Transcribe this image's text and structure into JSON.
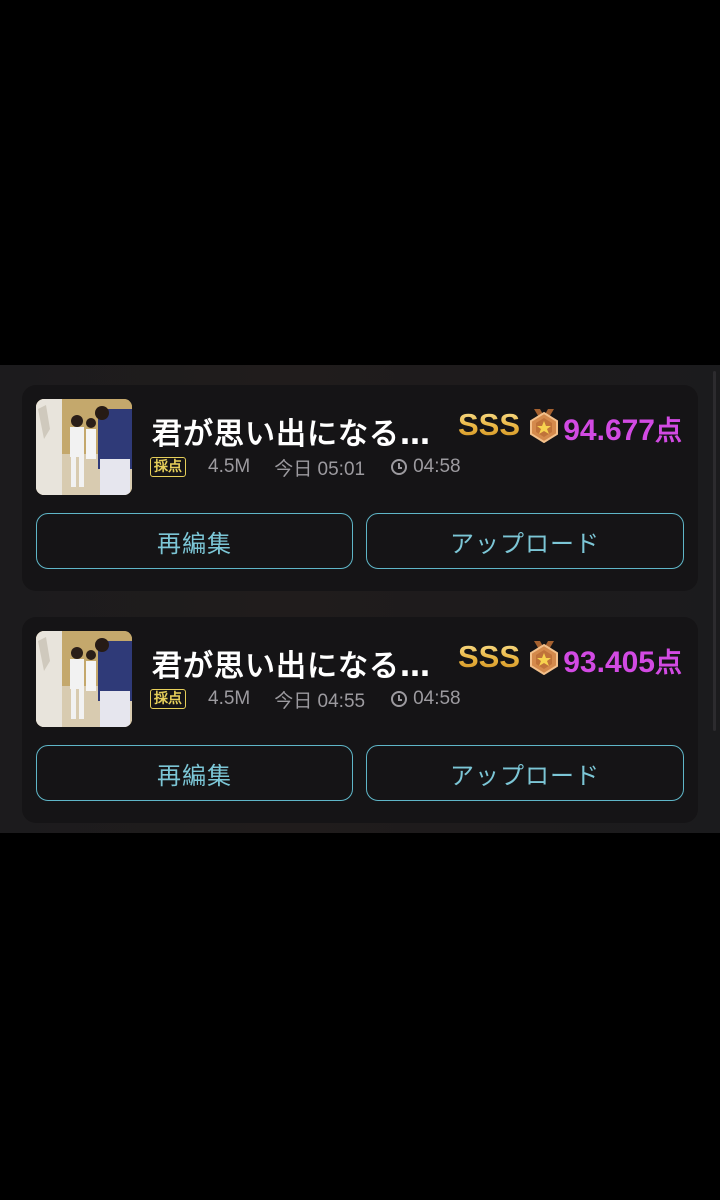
{
  "recordings": [
    {
      "title": "君が思い出になる…",
      "rank": "SSS",
      "score": "94.677",
      "score_unit": "点",
      "badge": "採点",
      "size": "4.5M",
      "date": "今日 05:01",
      "duration": "04:58",
      "edit_label": "再編集",
      "upload_label": "アップロード"
    },
    {
      "title": "君が思い出になる…",
      "rank": "SSS",
      "score": "93.405",
      "score_unit": "点",
      "badge": "採点",
      "size": "4.5M",
      "date": "今日 04:55",
      "duration": "04:58",
      "edit_label": "再編集",
      "upload_label": "アップロード"
    }
  ],
  "colors": {
    "score": "#d24ae3",
    "rank_gold": "#f0c45a",
    "button_border": "#5fb6c8",
    "badge": "#e6cf5a"
  }
}
